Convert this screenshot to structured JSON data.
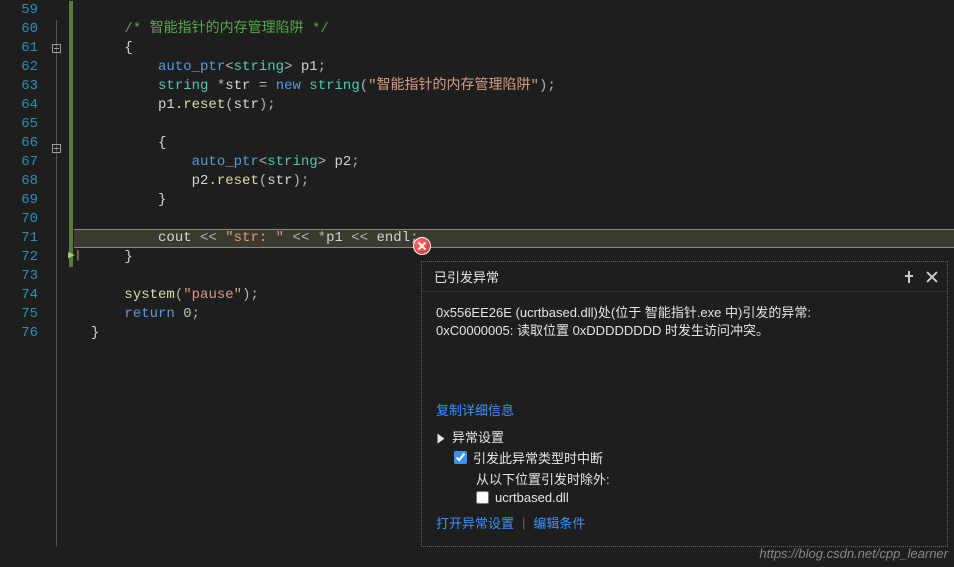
{
  "lines": {
    "59": "59",
    "60": "60",
    "61": "61",
    "62": "62",
    "63": "63",
    "64": "64",
    "65": "65",
    "66": "66",
    "67": "67",
    "68": "68",
    "69": "69",
    "70": "70",
    "71": "71",
    "72": "72",
    "73": "73",
    "74": "74",
    "75": "75",
    "76": "76"
  },
  "code": {
    "l60_comment": "/* 智能指针的内存管理陷阱 */",
    "l61_brace": "{",
    "l62_autoptr": "auto_ptr",
    "l62_string": "string",
    "l62_p1": "p1",
    "l62_semi": ";",
    "l63_string": "string",
    "l63_star": " *",
    "l63_str": "str",
    "l63_eq": " = ",
    "l63_new": "new",
    "l63_stringc": " string",
    "l63_paren_o": "(",
    "l63_lit": "\"智能指针的内存管理陷阱\"",
    "l63_paren_c": ")",
    "l63_semi": ";",
    "l64_p1": "p1",
    "l64_reset": ".reset",
    "l64_paren_o": "(",
    "l64_str": "str",
    "l64_paren_c": ")",
    "l64_semi": ";",
    "l66_brace": "{",
    "l67_autoptr": "auto_ptr",
    "l67_string": "string",
    "l67_p2": "p2",
    "l67_semi": ";",
    "l68_p2": "p2",
    "l68_reset": ".reset",
    "l68_paren_o": "(",
    "l68_str": "str",
    "l68_paren_c": ")",
    "l68_semi": ";",
    "l69_brace": "}",
    "l71_cout": "cout",
    "l71_op1": " << ",
    "l71_lit": "\"str: \"",
    "l71_op2": " << ",
    "l71_star": "*",
    "l71_p1": "p1",
    "l71_op3": " << ",
    "l71_endl": "endl",
    "l71_semi": ";",
    "l72_brace": "}",
    "l74_system": "system",
    "l74_paren_o": "(",
    "l74_lit": "\"pause\"",
    "l74_paren_c": ")",
    "l74_semi": ";",
    "l75_return": "return",
    "l75_zero": " 0",
    "l75_semi": ";",
    "l76_brace": "}"
  },
  "popup": {
    "title": "已引发异常",
    "msg1": "0x556EE26E (ucrtbased.dll)处(位于 智能指针.exe 中)引发的异常:",
    "msg2": "0xC0000005: 读取位置 0xDDDDDDDD 时发生访问冲突。",
    "copy_link": "复制详细信息",
    "section_title": "异常设置",
    "check_break": "引发此异常类型时中断",
    "except_from": "从以下位置引发时除外:",
    "dll": "ucrtbased.dll",
    "action_open": "打开异常设置",
    "action_edit": "编辑条件"
  },
  "watermark": "https://blog.csdn.net/cpp_learner"
}
